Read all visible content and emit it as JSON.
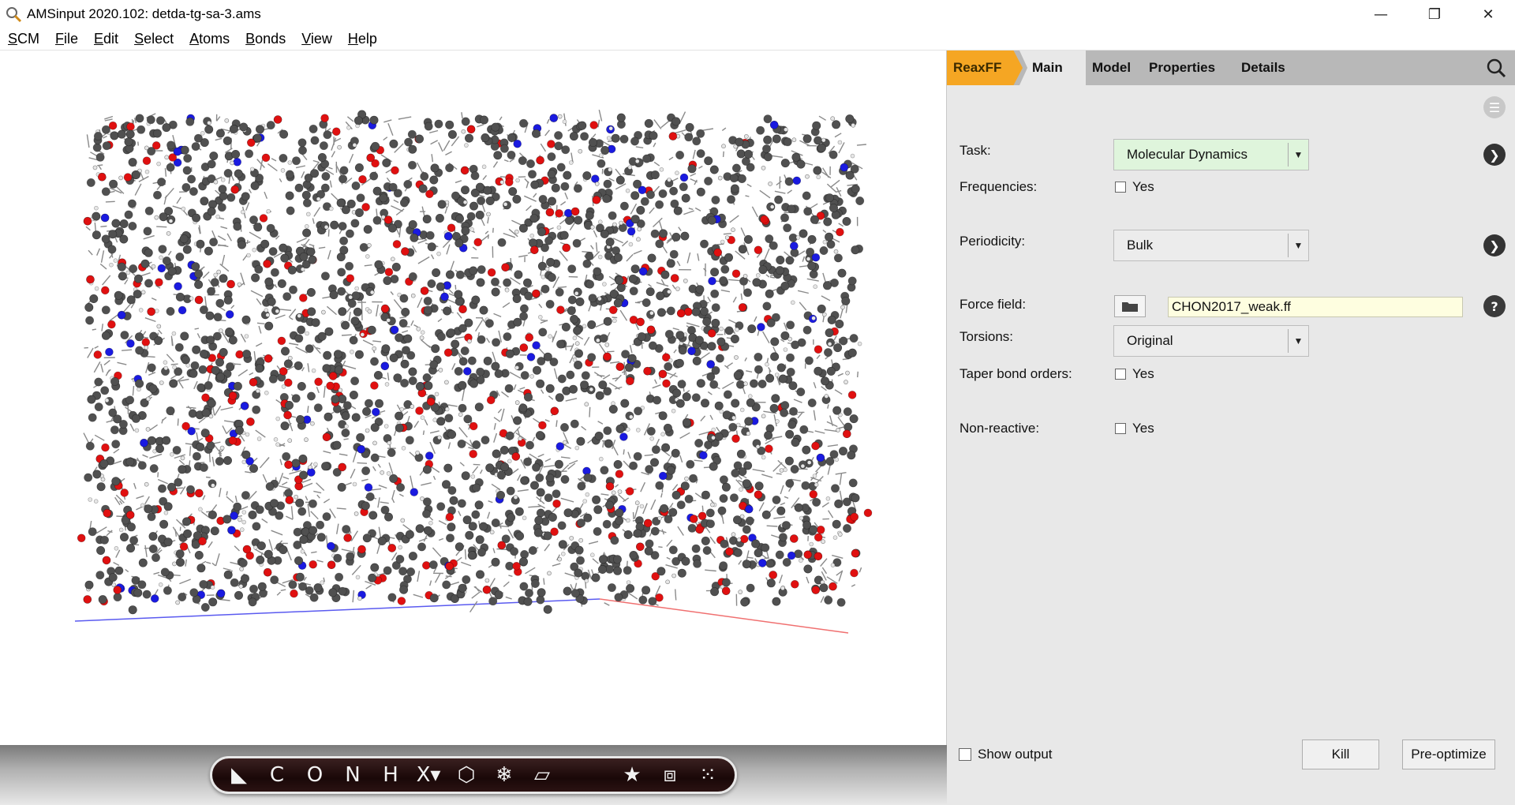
{
  "window": {
    "title": "AMSinput 2020.102: detda-tg-sa-3.ams",
    "minimize": "—",
    "restore": "❐",
    "close": "✕"
  },
  "menu": {
    "items": [
      {
        "first": "S",
        "rest": "CM"
      },
      {
        "first": "F",
        "rest": "ile"
      },
      {
        "first": "E",
        "rest": "dit"
      },
      {
        "first": "S",
        "rest": "elect"
      },
      {
        "first": "A",
        "rest": "toms"
      },
      {
        "first": "B",
        "rest": "onds"
      },
      {
        "first": "V",
        "rest": "iew"
      },
      {
        "first": "H",
        "rest": "elp"
      }
    ]
  },
  "toolbar": {
    "tools": [
      "◣",
      "C",
      "O",
      "N",
      "H",
      "X▾",
      "⬡",
      "❄",
      "▱"
    ],
    "right_tools": [
      "★",
      "⧈",
      "⁙"
    ]
  },
  "panel": {
    "tabs": {
      "reaxff": "ReaxFF",
      "main": "Main",
      "model": "Model",
      "properties": "Properties",
      "details": "Details"
    },
    "task": {
      "label": "Task:",
      "value": "Molecular Dynamics"
    },
    "frequencies": {
      "label": "Frequencies:",
      "option": "Yes"
    },
    "periodicity": {
      "label": "Periodicity:",
      "value": "Bulk"
    },
    "force_field": {
      "label": "Force field:",
      "value": "CHON2017_weak.ff"
    },
    "torsions": {
      "label": "Torsions:",
      "value": "Original"
    },
    "taper": {
      "label": "Taper bond orders:",
      "option": "Yes"
    },
    "nonreactive": {
      "label": "Non-reactive:",
      "option": "Yes"
    },
    "show_output": "Show output",
    "kill": "Kill",
    "preoptimize": "Pre-optimize",
    "help_glyph": "?",
    "next_glyph": "❯",
    "menu_glyph": "☰"
  },
  "colors": {
    "reaxff_tab": "#f5a623",
    "task_field": "#dff5dc",
    "forcefield_field": "#fefee0",
    "carbon": "#505050",
    "oxygen": "#e01010",
    "nitrogen": "#1a1ae0",
    "hydrogen": "#e6e6e6"
  }
}
